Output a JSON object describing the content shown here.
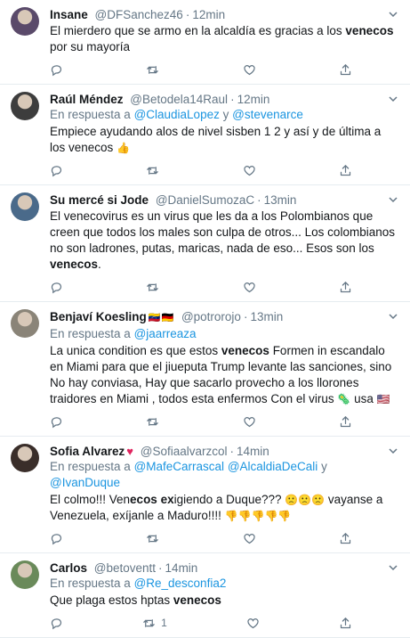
{
  "tweets": [
    {
      "name": "Insane",
      "handle": "@DFSanchez46",
      "time": "12min",
      "reply_to": null,
      "text_html": "El mierdero que se armo en la alcaldía es gracias a los <b>venecos</b> por su mayoría",
      "retweets": "",
      "avatar_color": "#5a4a6a"
    },
    {
      "name": "Raúl Méndez",
      "handle": "@Betodela14Raul",
      "time": "12min",
      "reply_prefix": "En respuesta a ",
      "reply_to": [
        "@ClaudiaLopez",
        "@stevenarce"
      ],
      "reply_joiner": " y ",
      "text_html": "Empiece ayudando alos de nivel sisben 1 2 y así y de última a los venecos <span class=\"emoji\">👍</span>",
      "retweets": "",
      "avatar_color": "#3d3d3d"
    },
    {
      "name": "Su mercé si Jode",
      "handle": "@DanielSumozaC",
      "time": "13min",
      "reply_to": null,
      "text_html": "El venecovirus es un virus que les da a los Polombianos que creen que todos los males son culpa de otros... Los colombianos no son ladrones, putas, maricas, nada de eso... Esos son los <b>venecos</b>.",
      "retweets": "",
      "avatar_color": "#4a6a8a"
    },
    {
      "name": "Benjaví Koesling",
      "name_flags": "🇻🇪🇩🇪",
      "handle": "@potrorojo",
      "time": "13min",
      "reply_prefix": "En respuesta a ",
      "reply_to": [
        "@jaarreaza"
      ],
      "text_html": "La unica condition es que estos <b>venecos</b> Formen in escandalo en Miami para que el jiueputa Trump levante las sanciones, sino No hay conviasa, Hay que sacarlo provecho a los llorones traidores en Miami , todos esta enfermos Con el virus <span class=\"emoji\">🦠</span> usa <span class=\"emoji\">🇺🇸</span>",
      "retweets": "",
      "avatar_color": "#8a8478"
    },
    {
      "name": "Sofia Alvarez",
      "name_heart": "♥",
      "handle": "@Sofiaalvarzcol",
      "time": "14min",
      "reply_prefix": "En respuesta a ",
      "reply_to": [
        "@MafeCarrascal",
        "@AlcaldiaDeCali",
        "@IvanDuque"
      ],
      "reply_joiner": " ",
      "reply_last_joiner": " y ",
      "text_html": "El colmo!!!  Ven<b>ecos</b> <b>ex</b>igiendo a Duque??? <span class=\"emoji\">🙁🙁🙁</span> vayanse a Venezuela,  exíjanle a Maduro!!!! <span class=\"emoji\">👎👎👎👎👎</span>",
      "retweets": "",
      "avatar_color": "#3a2e2a"
    },
    {
      "name": "Carlos",
      "handle": "@betoventt",
      "time": "14min",
      "reply_prefix": "En respuesta a ",
      "reply_to": [
        "@Re_desconfia2"
      ],
      "text_html": "Que plaga estos hptas <b>venecos</b>",
      "retweets": "1",
      "avatar_color": "#6a8a5a"
    }
  ]
}
